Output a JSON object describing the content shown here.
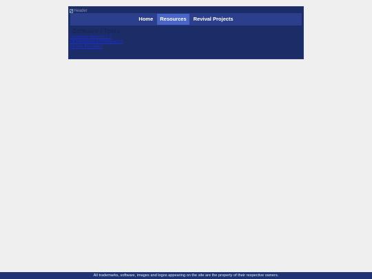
{
  "header": {
    "logo_alt": "Header"
  },
  "nav": {
    "items": [
      {
        "label": "Home"
      },
      {
        "label": "Resources"
      },
      {
        "label": "Revival Projects"
      }
    ]
  },
  "main": {
    "title": "Software / Tools",
    "links": [
      {
        "label": "Software Version 1.0"
      },
      {
        "label": "Of Headboard Printeract 2"
      },
      {
        "label": "Online Emulator"
      }
    ]
  },
  "footer": {
    "text": "All trademarks, software, images and logos appearing on the site are the property of their respective owners."
  }
}
